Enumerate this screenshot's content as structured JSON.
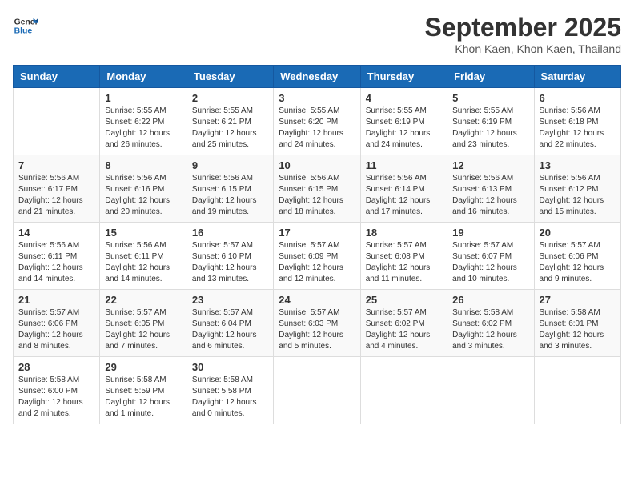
{
  "header": {
    "logo_line1": "General",
    "logo_line2": "Blue",
    "month": "September 2025",
    "location": "Khon Kaen, Khon Kaen, Thailand"
  },
  "weekdays": [
    "Sunday",
    "Monday",
    "Tuesday",
    "Wednesday",
    "Thursday",
    "Friday",
    "Saturday"
  ],
  "weeks": [
    [
      {
        "day": "",
        "info": ""
      },
      {
        "day": "1",
        "info": "Sunrise: 5:55 AM\nSunset: 6:22 PM\nDaylight: 12 hours\nand 26 minutes."
      },
      {
        "day": "2",
        "info": "Sunrise: 5:55 AM\nSunset: 6:21 PM\nDaylight: 12 hours\nand 25 minutes."
      },
      {
        "day": "3",
        "info": "Sunrise: 5:55 AM\nSunset: 6:20 PM\nDaylight: 12 hours\nand 24 minutes."
      },
      {
        "day": "4",
        "info": "Sunrise: 5:55 AM\nSunset: 6:19 PM\nDaylight: 12 hours\nand 24 minutes."
      },
      {
        "day": "5",
        "info": "Sunrise: 5:55 AM\nSunset: 6:19 PM\nDaylight: 12 hours\nand 23 minutes."
      },
      {
        "day": "6",
        "info": "Sunrise: 5:56 AM\nSunset: 6:18 PM\nDaylight: 12 hours\nand 22 minutes."
      }
    ],
    [
      {
        "day": "7",
        "info": "Sunrise: 5:56 AM\nSunset: 6:17 PM\nDaylight: 12 hours\nand 21 minutes."
      },
      {
        "day": "8",
        "info": "Sunrise: 5:56 AM\nSunset: 6:16 PM\nDaylight: 12 hours\nand 20 minutes."
      },
      {
        "day": "9",
        "info": "Sunrise: 5:56 AM\nSunset: 6:15 PM\nDaylight: 12 hours\nand 19 minutes."
      },
      {
        "day": "10",
        "info": "Sunrise: 5:56 AM\nSunset: 6:15 PM\nDaylight: 12 hours\nand 18 minutes."
      },
      {
        "day": "11",
        "info": "Sunrise: 5:56 AM\nSunset: 6:14 PM\nDaylight: 12 hours\nand 17 minutes."
      },
      {
        "day": "12",
        "info": "Sunrise: 5:56 AM\nSunset: 6:13 PM\nDaylight: 12 hours\nand 16 minutes."
      },
      {
        "day": "13",
        "info": "Sunrise: 5:56 AM\nSunset: 6:12 PM\nDaylight: 12 hours\nand 15 minutes."
      }
    ],
    [
      {
        "day": "14",
        "info": "Sunrise: 5:56 AM\nSunset: 6:11 PM\nDaylight: 12 hours\nand 14 minutes."
      },
      {
        "day": "15",
        "info": "Sunrise: 5:56 AM\nSunset: 6:11 PM\nDaylight: 12 hours\nand 14 minutes."
      },
      {
        "day": "16",
        "info": "Sunrise: 5:57 AM\nSunset: 6:10 PM\nDaylight: 12 hours\nand 13 minutes."
      },
      {
        "day": "17",
        "info": "Sunrise: 5:57 AM\nSunset: 6:09 PM\nDaylight: 12 hours\nand 12 minutes."
      },
      {
        "day": "18",
        "info": "Sunrise: 5:57 AM\nSunset: 6:08 PM\nDaylight: 12 hours\nand 11 minutes."
      },
      {
        "day": "19",
        "info": "Sunrise: 5:57 AM\nSunset: 6:07 PM\nDaylight: 12 hours\nand 10 minutes."
      },
      {
        "day": "20",
        "info": "Sunrise: 5:57 AM\nSunset: 6:06 PM\nDaylight: 12 hours\nand 9 minutes."
      }
    ],
    [
      {
        "day": "21",
        "info": "Sunrise: 5:57 AM\nSunset: 6:06 PM\nDaylight: 12 hours\nand 8 minutes."
      },
      {
        "day": "22",
        "info": "Sunrise: 5:57 AM\nSunset: 6:05 PM\nDaylight: 12 hours\nand 7 minutes."
      },
      {
        "day": "23",
        "info": "Sunrise: 5:57 AM\nSunset: 6:04 PM\nDaylight: 12 hours\nand 6 minutes."
      },
      {
        "day": "24",
        "info": "Sunrise: 5:57 AM\nSunset: 6:03 PM\nDaylight: 12 hours\nand 5 minutes."
      },
      {
        "day": "25",
        "info": "Sunrise: 5:57 AM\nSunset: 6:02 PM\nDaylight: 12 hours\nand 4 minutes."
      },
      {
        "day": "26",
        "info": "Sunrise: 5:58 AM\nSunset: 6:02 PM\nDaylight: 12 hours\nand 3 minutes."
      },
      {
        "day": "27",
        "info": "Sunrise: 5:58 AM\nSunset: 6:01 PM\nDaylight: 12 hours\nand 3 minutes."
      }
    ],
    [
      {
        "day": "28",
        "info": "Sunrise: 5:58 AM\nSunset: 6:00 PM\nDaylight: 12 hours\nand 2 minutes."
      },
      {
        "day": "29",
        "info": "Sunrise: 5:58 AM\nSunset: 5:59 PM\nDaylight: 12 hours\nand 1 minute."
      },
      {
        "day": "30",
        "info": "Sunrise: 5:58 AM\nSunset: 5:58 PM\nDaylight: 12 hours\nand 0 minutes."
      },
      {
        "day": "",
        "info": ""
      },
      {
        "day": "",
        "info": ""
      },
      {
        "day": "",
        "info": ""
      },
      {
        "day": "",
        "info": ""
      }
    ]
  ]
}
